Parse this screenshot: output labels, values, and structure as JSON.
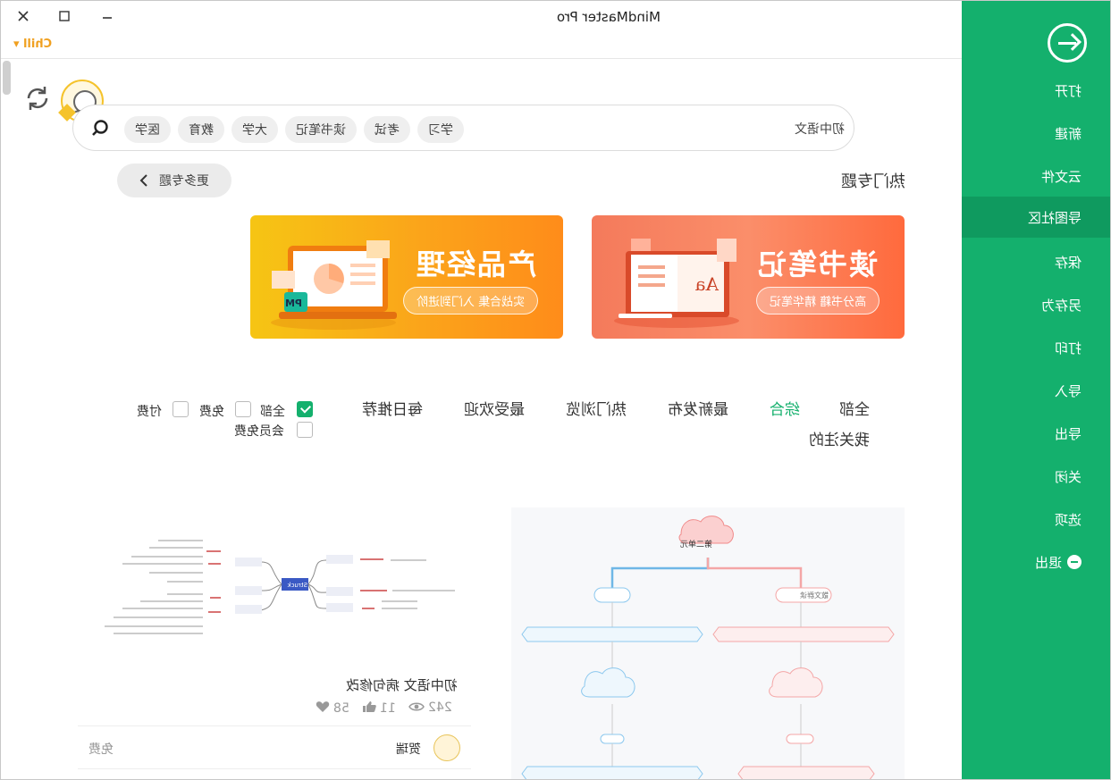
{
  "window": {
    "title": "MindMaster Pro",
    "theme_menu": "Chill"
  },
  "sidebar": {
    "items": [
      {
        "label": "打开"
      },
      {
        "label": "新建"
      },
      {
        "label": "云文件"
      },
      {
        "label": "导图社区",
        "active": true
      },
      {
        "label": "保存"
      },
      {
        "label": "另存为"
      },
      {
        "label": "打印"
      },
      {
        "label": "导入"
      },
      {
        "label": "导出"
      },
      {
        "label": "关闭"
      },
      {
        "label": "选项"
      },
      {
        "label": "退出"
      }
    ],
    "color": "#14b06d"
  },
  "search": {
    "value": "初中语文",
    "tags": [
      "学习",
      "考试",
      "读书笔记",
      "大学",
      "教育",
      "医学"
    ]
  },
  "hot_topics": {
    "title": "热门专题",
    "more_label": "更多专题",
    "banners": [
      {
        "title": "读书笔记",
        "subtitle": "高分书籍 精华笔记",
        "icon_text": "Aa"
      },
      {
        "title": "产品经理",
        "subtitle": "实战合集 入门到进阶",
        "icon_text": "PM"
      }
    ]
  },
  "filters": {
    "tabs": [
      {
        "label": "全部"
      },
      {
        "label": "综合",
        "active": true
      },
      {
        "label": "最新发布"
      },
      {
        "label": "热门浏览"
      },
      {
        "label": "最受欢迎"
      },
      {
        "label": "每日推荐"
      },
      {
        "label": "我关注的"
      }
    ],
    "price": [
      {
        "label": "全部",
        "checked": true
      },
      {
        "label": "免费",
        "checked": false
      },
      {
        "label": "付费",
        "checked": false
      },
      {
        "label": "会员免费",
        "checked": false
      }
    ]
  },
  "cards": [
    {
      "title": "初中语文 病句修改",
      "views": "242",
      "likes": "11",
      "favorites": "58",
      "author": "贺瑞",
      "price": "免费",
      "center_node": "Struck"
    },
    {
      "center_node": "第二单元",
      "branches": [
        "散文群读",
        "综合"
      ]
    }
  ]
}
